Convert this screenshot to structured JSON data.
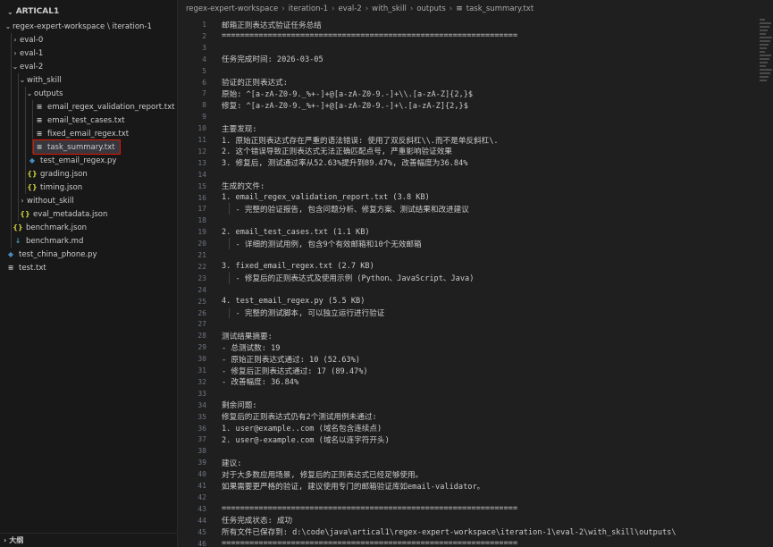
{
  "explorer": {
    "header": "ARTICAL1",
    "items": [
      {
        "label": "regex-expert-workspace \\ iteration-1",
        "depth": 1,
        "chevron": "⌄",
        "icon": ""
      },
      {
        "label": "eval-0",
        "depth": 2,
        "chevron": "›",
        "icon": ""
      },
      {
        "label": "eval-1",
        "depth": 2,
        "chevron": "›",
        "icon": ""
      },
      {
        "label": "eval-2",
        "depth": 2,
        "chevron": "⌄",
        "icon": ""
      },
      {
        "label": "with_skill",
        "depth": 3,
        "chevron": "⌄",
        "icon": ""
      },
      {
        "label": "outputs",
        "depth": 4,
        "chevron": "⌄",
        "icon": ""
      },
      {
        "label": "email_regex_validation_report.txt",
        "depth": 5,
        "chevron": "",
        "icon": "≡"
      },
      {
        "label": "email_test_cases.txt",
        "depth": 5,
        "chevron": "",
        "icon": "≡"
      },
      {
        "label": "fixed_email_regex.txt",
        "depth": 5,
        "chevron": "",
        "icon": "≡"
      },
      {
        "label": "task_summary.txt",
        "depth": 5,
        "chevron": "",
        "icon": "≡",
        "selected": true
      },
      {
        "label": "test_email_regex.py",
        "depth": 4,
        "chevron": "",
        "icon": "◆"
      },
      {
        "label": "grading.json",
        "depth": 4,
        "chevron": "",
        "icon": "{}"
      },
      {
        "label": "timing.json",
        "depth": 4,
        "chevron": "",
        "icon": "{}"
      },
      {
        "label": "without_skill",
        "depth": 3,
        "chevron": "›",
        "icon": ""
      },
      {
        "label": "eval_metadata.json",
        "depth": 3,
        "chevron": "",
        "icon": "{}"
      },
      {
        "label": "benchmark.json",
        "depth": 2,
        "chevron": "",
        "icon": "{}"
      },
      {
        "label": "benchmark.md",
        "depth": 2,
        "chevron": "",
        "icon": "↓"
      },
      {
        "label": "test_china_phone.py",
        "depth": 1,
        "chevron": "",
        "icon": "◆"
      },
      {
        "label": "test.txt",
        "depth": 1,
        "chevron": "",
        "icon": "≡"
      }
    ],
    "outline_header": "大纲"
  },
  "colors": {
    "folder_text": "#cccccc",
    "txt_icon": "#c5c5c5",
    "json_icon": "#cbcb41",
    "py_icon": "#4b8bbe",
    "md_icon": "#519aba",
    "selection_border": "#e51400"
  },
  "breadcrumb": [
    "regex-expert-workspace",
    "iteration-1",
    "eval-2",
    "with_skill",
    "outputs",
    "task_summary.txt"
  ],
  "editor": {
    "lines": [
      "邮箱正则表达式验证任务总结",
      "================================================================",
      "",
      "任务完成时间: 2026-03-05",
      "",
      "验证的正则表达式:",
      "原始: ^[a-zA-Z0-9._%+-]+@[a-zA-Z0-9.-]+\\\\.[a-zA-Z]{2,}$",
      "修复: ^[a-zA-Z0-9._%+-]+@[a-zA-Z0-9.-]+\\.[a-zA-Z]{2,}$",
      "",
      "主要发现:",
      "1. 原始正则表达式存在严重的语法错误: 使用了双反斜杠\\\\.而不是单反斜杠\\.",
      "2. 这个错误导致正则表达式无法正确匹配点号, 严重影响验证效果",
      "3. 修复后, 测试通过率从52.63%提升到89.47%, 改善幅度为36.84%",
      "",
      "生成的文件:",
      "1. email_regex_validation_report.txt (3.8 KB)",
      "   - 完整的验证报告, 包含问题分析、修复方案、测试结果和改进建议",
      "",
      "2. email_test_cases.txt (1.1 KB)",
      "   - 详细的测试用例, 包含9个有效邮箱和10个无效邮箱",
      "",
      "3. fixed_email_regex.txt (2.7 KB)",
      "   - 修复后的正则表达式及使用示例 (Python、JavaScript、Java)",
      "",
      "4. test_email_regex.py (5.5 KB)",
      "   - 完整的测试脚本, 可以独立运行进行验证",
      "",
      "测试结果摘要:",
      "- 总测试数: 19",
      "- 原始正则表达式通过: 10 (52.63%)",
      "- 修复后正则表达式通过: 17 (89.47%)",
      "- 改善幅度: 36.84%",
      "",
      "剩余问题:",
      "修复后的正则表达式仍有2个测试用例未通过:",
      "1. user@example..com (域名包含连续点)",
      "2. user@-example.com (域名以连字符开头)",
      "",
      "建议:",
      "对于大多数应用场景, 修复后的正则表达式已经足够使用。",
      "如果需要更严格的验证, 建议使用专门的邮箱验证库如email-validator。",
      "",
      "================================================================",
      "任务完成状态: 成功",
      "所有文件已保存到: d:\\code\\java\\artical1\\regex-expert-workspace\\iteration-1\\eval-2\\with_skill\\outputs\\",
      "================================================================"
    ]
  }
}
